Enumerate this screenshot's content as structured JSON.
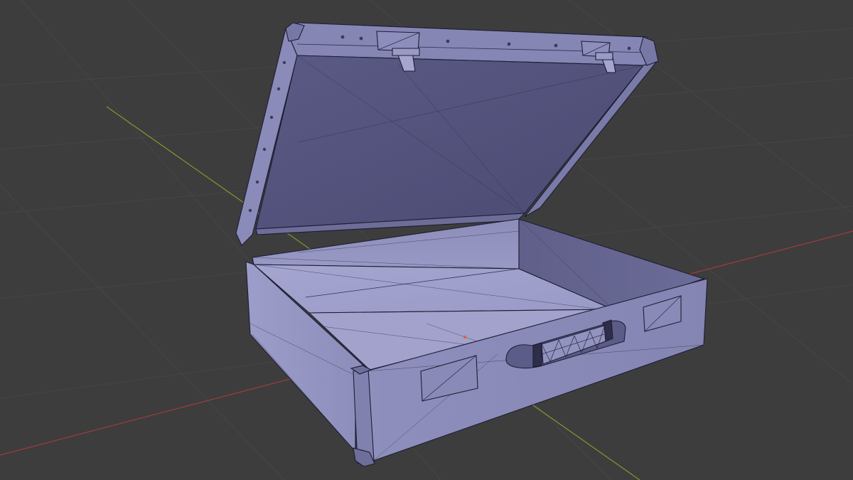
{
  "viewport": {
    "background": "#3d3d3d",
    "grid_color": "#484848",
    "x_axis_color": "#a13c3c",
    "y_axis_color": "#7f9a2e",
    "mesh_color_light": "#9b9bc7",
    "mesh_color_mid": "#7f7fae",
    "mesh_color_dark": "#4a4a72",
    "wire_color": "#20203a",
    "origin_color": "#e0603a"
  },
  "scene": {
    "object": "suitcase-mesh",
    "mode": "wireframe-overlay"
  }
}
